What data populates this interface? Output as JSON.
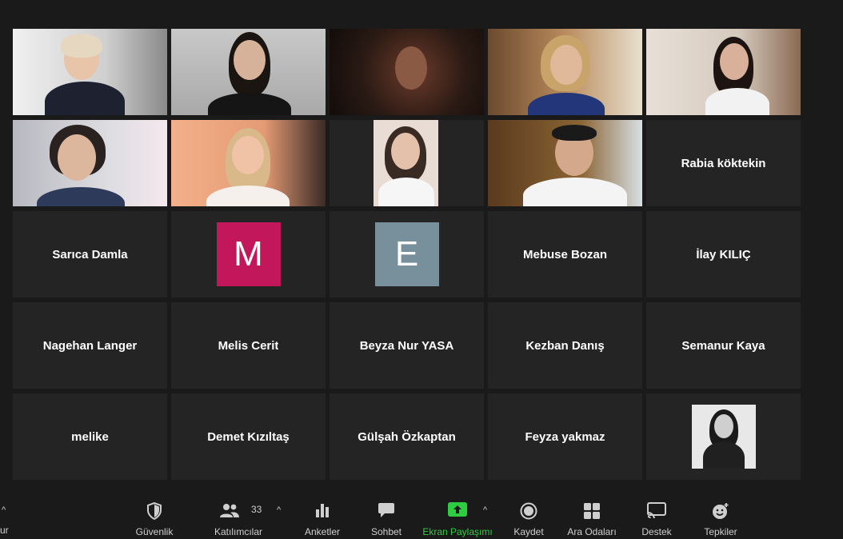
{
  "participants": {
    "named_tiles": [
      "Rabia köktekin",
      "Sarıca Damla",
      "Mebuse Bozan",
      "İlay KILIÇ",
      "Nagehan Langer",
      "Melis Cerit",
      "Beyza Nur YASA",
      "Kezban Danış",
      "Semanur Kaya",
      "melike",
      "Demet Kızıltaş",
      "Gülşah  Özkaptan",
      "Feyza yakmaz"
    ],
    "avatars": [
      "M",
      "E"
    ]
  },
  "toolbar": {
    "left_caret": "^",
    "left_partial": "ur",
    "security": "Güvenlik",
    "participants": "Katılımcılar",
    "participants_count": "33",
    "polls": "Anketler",
    "chat": "Sohbet",
    "share": "Ekran Paylaşımı",
    "record": "Kaydet",
    "breakout": "Ara Odaları",
    "support": "Destek",
    "reactions": "Tepkiler"
  },
  "colors": {
    "active_speaker": "#cfe067",
    "share_green": "#2ecc40",
    "avatar_m": "#c2185b",
    "avatar_e": "#78909c"
  }
}
